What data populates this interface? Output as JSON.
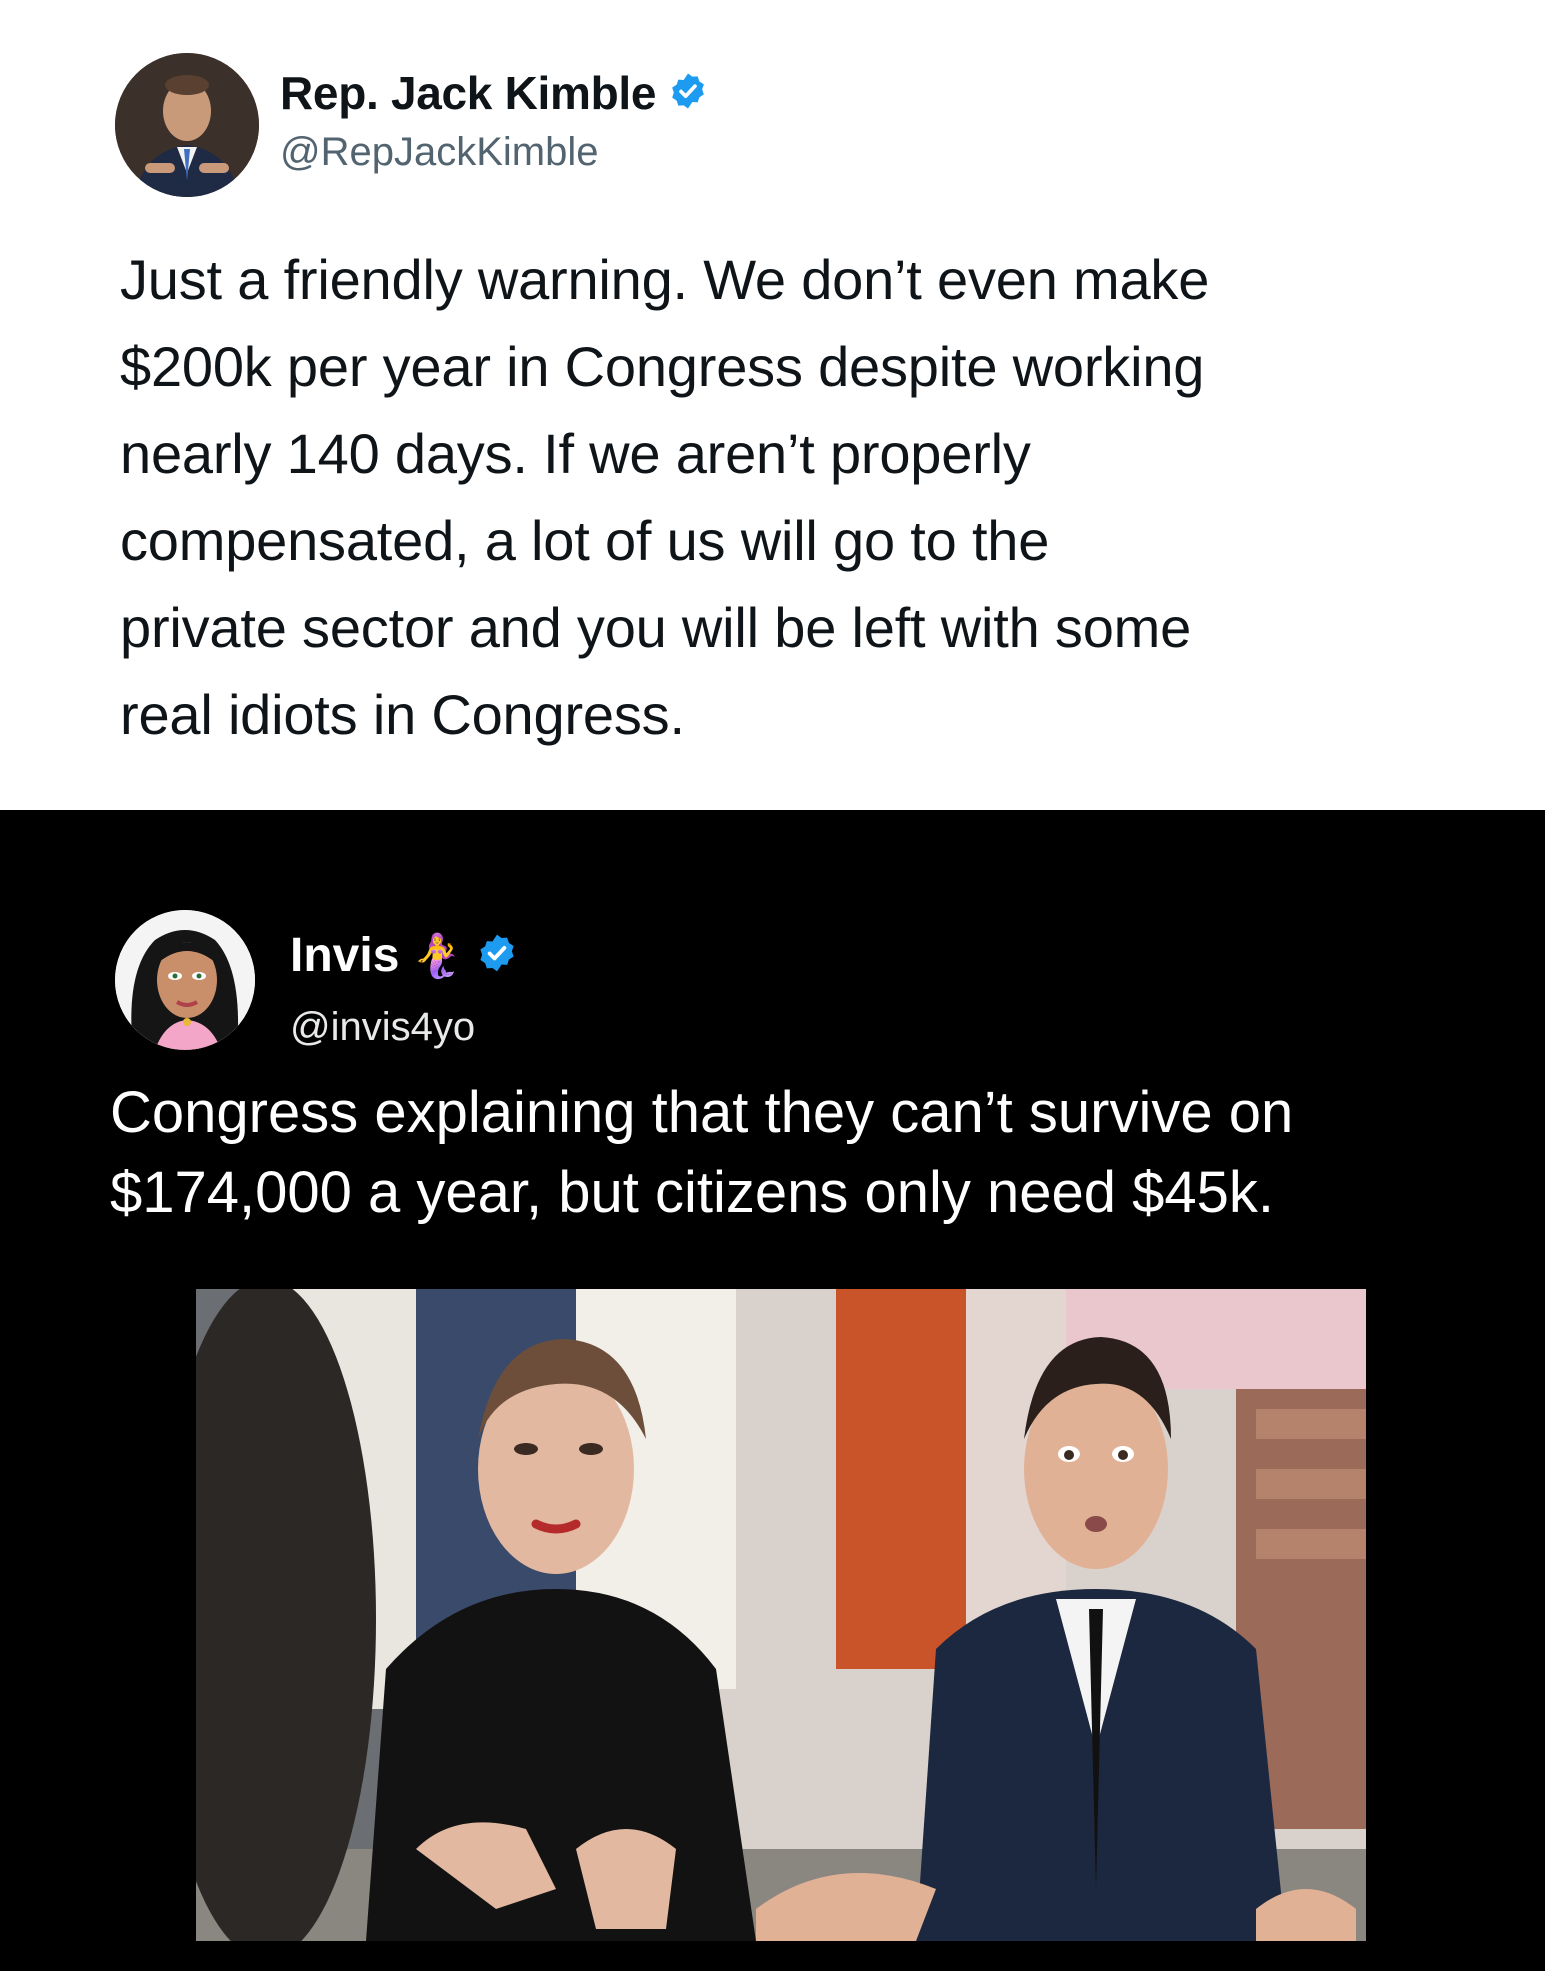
{
  "tweets": [
    {
      "display_name": "Rep. Jack Kimble",
      "handle": "@RepJackKimble",
      "verified": true,
      "text": "Just a friendly warning. We don’t even make\n$200k per year in Congress despite working\nnearly 140 days.  If we aren’t properly\ncompensated, a lot of us will go to the\nprivate sector and you will be left with some\nreal idiots in Congress.",
      "avatar_icon": "man-in-suit-avatar"
    },
    {
      "display_name": "Invis",
      "name_emoji": "🧜‍♀️",
      "handle": "@invis4yo",
      "verified": true,
      "text": "Congress explaining that they can’t survive on\n$174,000 a year, but citizens only need $45k.",
      "avatar_icon": "cartoon-woman-avatar",
      "media": "photo-two-people-seated-at-table"
    }
  ],
  "colors": {
    "verified_blue": "#1d9bf0",
    "light_bg": "#ffffff",
    "dark_bg": "#000000",
    "handle_gray": "#536471"
  }
}
